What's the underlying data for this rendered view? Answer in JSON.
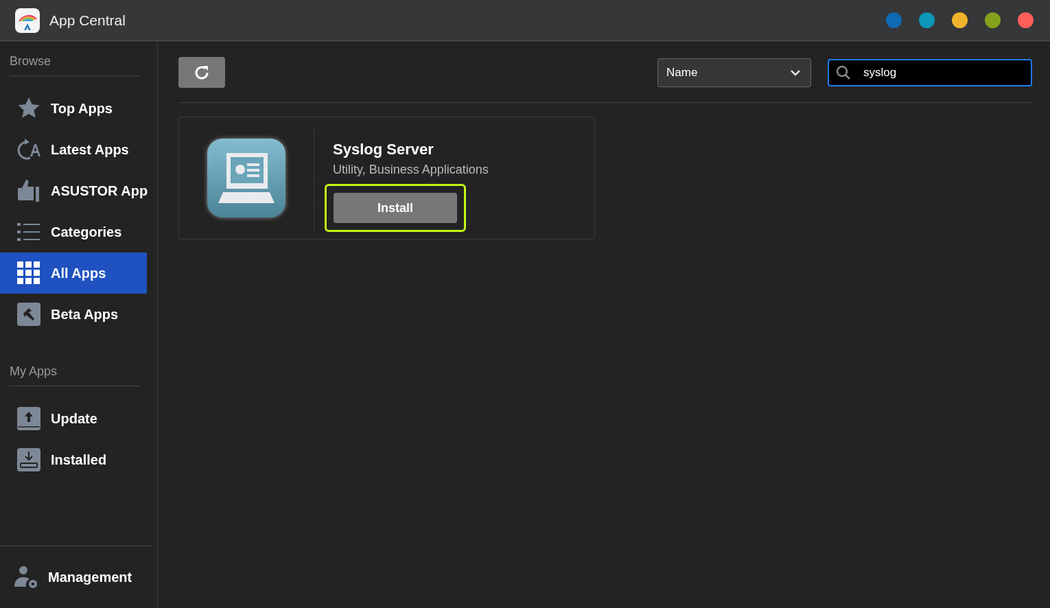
{
  "window": {
    "title": "App Central",
    "buttons": [
      {
        "color": "#0f6ab4"
      },
      {
        "color": "#0c97b8"
      },
      {
        "color": "#f0b42c"
      },
      {
        "color": "#84a21c"
      },
      {
        "color": "#fe5f5a"
      }
    ]
  },
  "sidebar": {
    "sections": [
      {
        "heading": "Browse",
        "items": [
          {
            "kind": "star",
            "label": "Top Apps",
            "selected": false
          },
          {
            "kind": "latest",
            "label": "Latest Apps",
            "selected": false
          },
          {
            "kind": "thumb",
            "label": "ASUSTOR App",
            "selected": false
          },
          {
            "kind": "list",
            "label": "Categories",
            "selected": false
          },
          {
            "kind": "grid",
            "label": "All Apps",
            "selected": true
          },
          {
            "kind": "hammer",
            "label": "Beta Apps",
            "selected": false
          }
        ]
      },
      {
        "heading": "My Apps",
        "items": [
          {
            "kind": "upload",
            "label": "Update",
            "selected": false
          },
          {
            "kind": "download",
            "label": "Installed",
            "selected": false
          }
        ]
      }
    ],
    "footer": {
      "kind": "user-gear",
      "label": "Management"
    }
  },
  "toolbar": {
    "sort": {
      "value": "Name"
    },
    "search": {
      "value": "syslog",
      "focused": true
    }
  },
  "apps": [
    {
      "name": "Syslog Server",
      "categories": "Utility, Business Applications",
      "action": {
        "label": "Install",
        "highlighted": true
      }
    }
  ]
}
